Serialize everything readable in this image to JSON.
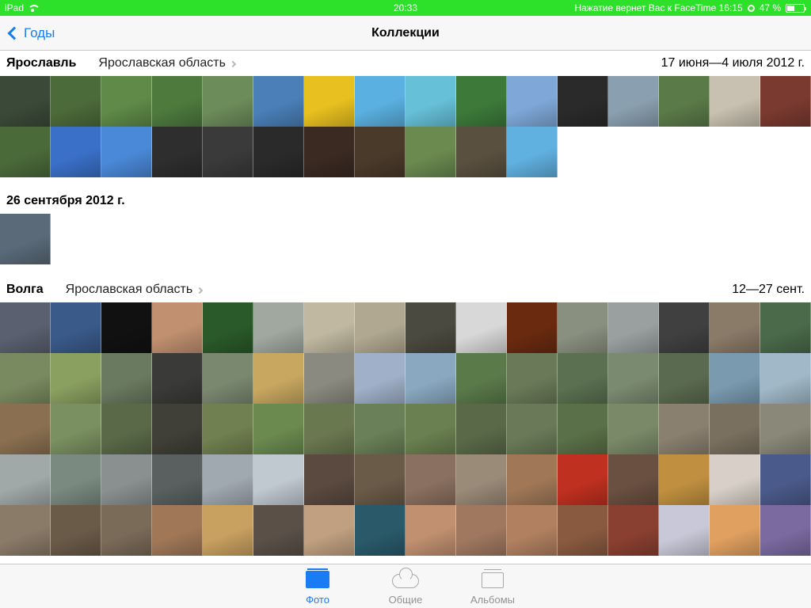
{
  "status_bar": {
    "device": "iPad",
    "time": "20:33",
    "facetime_notice": "Нажатие вернет Вас к FaceTime 16:15",
    "battery": "47 %"
  },
  "nav": {
    "back_label": "Годы",
    "title": "Коллекции"
  },
  "sections": [
    {
      "title": "Ярославль",
      "subtitle": "Ярославская область",
      "date_range": "17 июня—4 июля 2012 г.",
      "photos": [
        "#3b4a38",
        "#4c6b3a",
        "#5f8a48",
        "#4e7a3e",
        "#6c8c5a",
        "#4a7fb8",
        "#e8c020",
        "#5ab0e0",
        "#66c0d8",
        "#3d7a3a",
        "#7fa8d8",
        "#2a2a2a",
        "#8aa0b0",
        "#5a7a48",
        "#c8c0b0",
        "#7a3a30",
        "#4a6a3a",
        "#3a70c8",
        "#4a88d8",
        "#2e2e2e",
        "#3a3a3a",
        "#2a2a2a",
        "#3a2a22",
        "#4a3a2a",
        "#6a8a50",
        "#5a5040",
        "#60b0e0"
      ]
    },
    {
      "title": "26 сентября 2012 г.",
      "subtitle": "",
      "date_range": "",
      "photos": [
        "#5a6a78"
      ]
    },
    {
      "title": "Волга",
      "subtitle": "Ярославская область",
      "date_range": "12—27 сент.",
      "photos": [
        "#5a6070",
        "#3a5a8a",
        "#111111",
        "#c09070",
        "#2a5a2a",
        "#a0a8a0",
        "#c0b8a0",
        "#b0a890",
        "#4a4a40",
        "#d8d8d8",
        "#6a2a10",
        "#8a9080",
        "#9aa0a0",
        "#404040",
        "#8a7a68",
        "#4a6a4a",
        "#7a8a60",
        "#8aa060",
        "#6a7a60",
        "#3a3a38",
        "#7a8870",
        "#c8a860",
        "#8a8a80",
        "#a0b0c8",
        "#8aa8c0",
        "#5a7a4a",
        "#6a7a58",
        "#5a7050",
        "#7a8a70",
        "#5a6a50",
        "#7a9ab0",
        "#a0b8c8",
        "#8a7050",
        "#7a9060",
        "#5a6a48",
        "#404038",
        "#708050",
        "#6a8a50",
        "#6a7850",
        "#6a8058",
        "#6a8050",
        "#5a6a48",
        "#6a7a58",
        "#5a7048",
        "#7a8a68",
        "#8a8070",
        "#7a7060",
        "#8a8878",
        "#a0a8a8",
        "#7a8a80",
        "#8a9090",
        "#5a6060",
        "#a0a8b0",
        "#c0c8d0",
        "#5a4a40",
        "#6a5a48",
        "#8a7060",
        "#9a8a78",
        "#a07858",
        "#c03020",
        "#6a5040",
        "#c09040",
        "#d8d0c8",
        "#4a5a8a",
        "#8a7a68",
        "#6a5a48",
        "#7a6a58",
        "#a07858",
        "#c8a060",
        "#5a5048",
        "#c0a080",
        "#2a5a6a",
        "#c09070",
        "#a07860",
        "#b08060",
        "#8a5a40",
        "#8a4030",
        "#c8c8d8",
        "#e0a060",
        "#7a6aa0"
      ]
    }
  ],
  "tabs": [
    {
      "label": "Фото",
      "active": true
    },
    {
      "label": "Общие",
      "active": false
    },
    {
      "label": "Альбомы",
      "active": false
    }
  ],
  "colors": {
    "status_bar": "#2de02a",
    "accent": "#1a7cf5",
    "inactive_tab": "#929292"
  }
}
